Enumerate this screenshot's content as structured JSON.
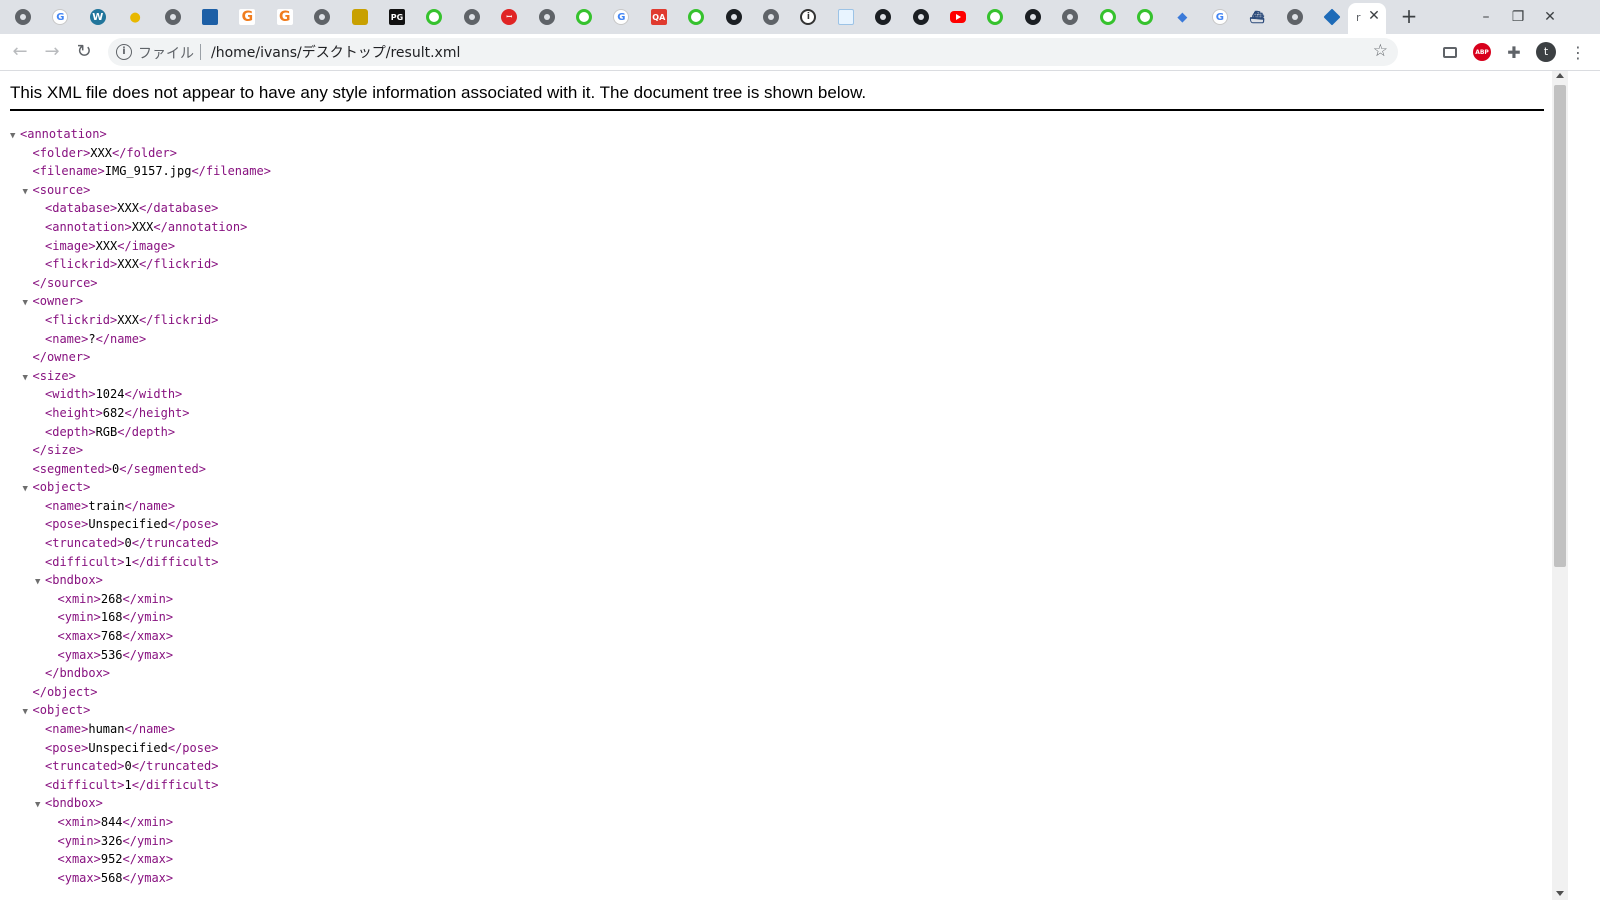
{
  "browser": {
    "active_tab": {
      "label": "r"
    },
    "address_bar": {
      "scheme_label": "ファイル",
      "url": "/home/ivans/デスクトップ/result.xml"
    },
    "profile_initial": "t",
    "extension_abp_label": "ABP",
    "tab_icons": [
      "globe",
      "google",
      "wordpress",
      "bulb",
      "globe",
      "blue-square",
      "g-orange",
      "g-orange",
      "globe",
      "trophy",
      "pg-black",
      "green-circle",
      "globe",
      "red-circle",
      "globe",
      "green-circle",
      "google",
      "qa-red",
      "green-circle",
      "github",
      "globe",
      "info",
      "image",
      "github",
      "github",
      "youtube",
      "green-circle",
      "github",
      "globe",
      "green-circle",
      "green-circle",
      "grad-hat",
      "google",
      "ship",
      "globe",
      "diamond"
    ],
    "tab_glyphs": {
      "google": "G",
      "g-orange": "G",
      "wordpress": "W",
      "bulb": "●",
      "pg-black": "PG",
      "red-circle": "ꟷ",
      "qa-red": "QA",
      "info": "i",
      "grad-hat": "◆",
      "ship": "⛴"
    }
  },
  "xml_viewer": {
    "notice": "This XML file does not appear to have any style information associated with it. The document tree is shown below.",
    "lines": [
      {
        "indent": 0,
        "toggle": true,
        "open": "annotation"
      },
      {
        "indent": 1,
        "open": "folder",
        "text": "XXX",
        "close": "folder"
      },
      {
        "indent": 1,
        "open": "filename",
        "text": "IMG_9157.jpg",
        "close": "filename"
      },
      {
        "indent": 1,
        "toggle": true,
        "open": "source"
      },
      {
        "indent": 2,
        "open": "database",
        "text": "XXX",
        "close": "database"
      },
      {
        "indent": 2,
        "open": "annotation",
        "text": "XXX",
        "close": "annotation"
      },
      {
        "indent": 2,
        "open": "image",
        "text": "XXX",
        "close": "image"
      },
      {
        "indent": 2,
        "open": "flickrid",
        "text": "XXX",
        "close": "flickrid"
      },
      {
        "indent": 1,
        "close": "source"
      },
      {
        "indent": 1,
        "toggle": true,
        "open": "owner"
      },
      {
        "indent": 2,
        "open": "flickrid",
        "text": "XXX",
        "close": "flickrid"
      },
      {
        "indent": 2,
        "open": "name",
        "text": "?",
        "close": "name"
      },
      {
        "indent": 1,
        "close": "owner"
      },
      {
        "indent": 1,
        "toggle": true,
        "open": "size"
      },
      {
        "indent": 2,
        "open": "width",
        "text": "1024",
        "close": "width"
      },
      {
        "indent": 2,
        "open": "height",
        "text": "682",
        "close": "height"
      },
      {
        "indent": 2,
        "open": "depth",
        "text": "RGB",
        "close": "depth"
      },
      {
        "indent": 1,
        "close": "size"
      },
      {
        "indent": 1,
        "open": "segmented",
        "text": "0",
        "close": "segmented"
      },
      {
        "indent": 1,
        "toggle": true,
        "open": "object"
      },
      {
        "indent": 2,
        "open": "name",
        "text": "train",
        "close": "name"
      },
      {
        "indent": 2,
        "open": "pose",
        "text": "Unspecified",
        "close": "pose"
      },
      {
        "indent": 2,
        "open": "truncated",
        "text": "0",
        "close": "truncated"
      },
      {
        "indent": 2,
        "open": "difficult",
        "text": "1",
        "close": "difficult"
      },
      {
        "indent": 2,
        "toggle": true,
        "open": "bndbox"
      },
      {
        "indent": 3,
        "open": "xmin",
        "text": "268",
        "close": "xmin"
      },
      {
        "indent": 3,
        "open": "ymin",
        "text": "168",
        "close": "ymin"
      },
      {
        "indent": 3,
        "open": "xmax",
        "text": "768",
        "close": "xmax"
      },
      {
        "indent": 3,
        "open": "ymax",
        "text": "536",
        "close": "ymax"
      },
      {
        "indent": 2,
        "close": "bndbox"
      },
      {
        "indent": 1,
        "close": "object"
      },
      {
        "indent": 1,
        "toggle": true,
        "open": "object"
      },
      {
        "indent": 2,
        "open": "name",
        "text": "human",
        "close": "name"
      },
      {
        "indent": 2,
        "open": "pose",
        "text": "Unspecified",
        "close": "pose"
      },
      {
        "indent": 2,
        "open": "truncated",
        "text": "0",
        "close": "truncated"
      },
      {
        "indent": 2,
        "open": "difficult",
        "text": "1",
        "close": "difficult"
      },
      {
        "indent": 2,
        "toggle": true,
        "open": "bndbox"
      },
      {
        "indent": 3,
        "open": "xmin",
        "text": "844",
        "close": "xmin"
      },
      {
        "indent": 3,
        "open": "ymin",
        "text": "326",
        "close": "ymin"
      },
      {
        "indent": 3,
        "open": "xmax",
        "text": "952",
        "close": "xmax"
      },
      {
        "indent": 3,
        "open": "ymax",
        "text": "568",
        "close": "ymax"
      }
    ]
  },
  "colors": {
    "tag": "#881280",
    "tab_strip": "#dee1e6",
    "omnibox": "#f1f3f4"
  }
}
